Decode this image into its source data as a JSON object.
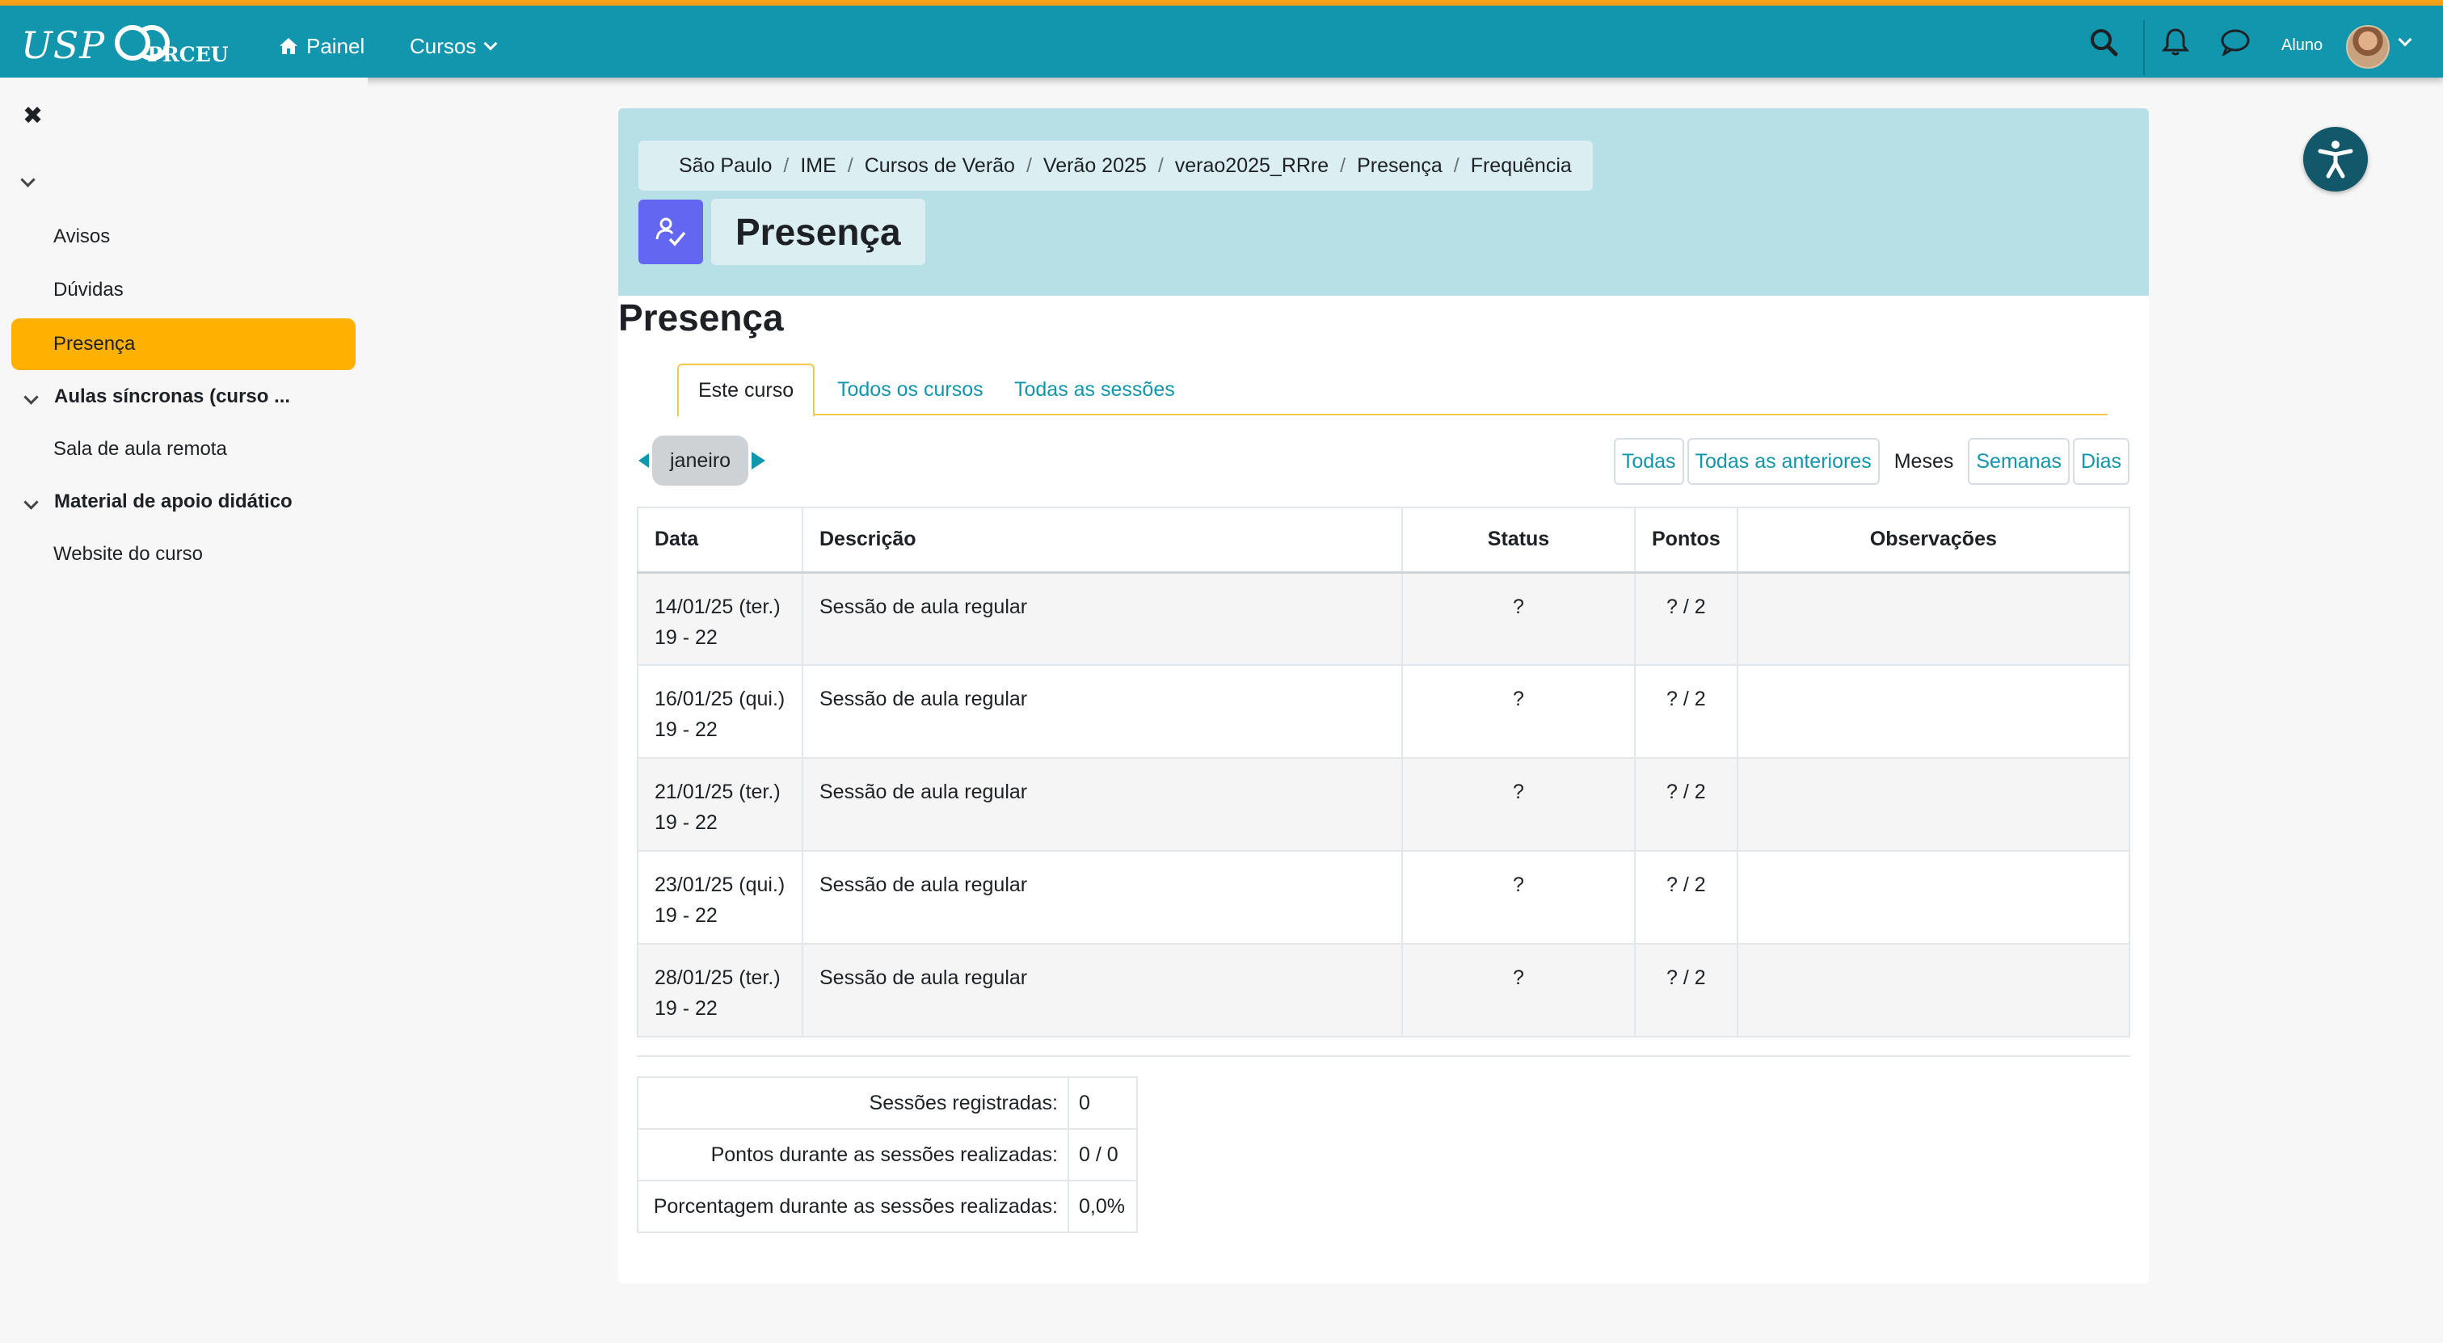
{
  "navbar": {
    "logo_text": "USP",
    "logo_sub": "PRCEU",
    "painel_label": "Painel",
    "cursos_label": "Cursos",
    "user_name": "Aluno",
    "colors": {
      "bar": "#1196ad",
      "accent": "#f5a21b"
    }
  },
  "sidebar": {
    "items": [
      {
        "label": "Avisos",
        "active": false
      },
      {
        "label": "Dúvidas",
        "active": false
      },
      {
        "label": "Presença",
        "active": true
      }
    ],
    "section_sync": "Aulas síncronas (curso ...",
    "section_sync_item": "Sala de aula remota",
    "section_material": "Material de apoio didático",
    "section_material_item": "Website do curso",
    "active_color": "#ffb000"
  },
  "breadcrumb": [
    "São Paulo",
    "IME",
    "Cursos de Verão",
    "Verão 2025",
    "verao2025_RRre",
    "Presença",
    "Frequência"
  ],
  "page_title": "Presença",
  "section_heading": "Presença",
  "tabs": [
    {
      "label": "Este curso",
      "active": true
    },
    {
      "label": "Todos os cursos",
      "active": false
    },
    {
      "label": "Todas as sessões",
      "active": false
    }
  ],
  "month": "janeiro",
  "view_filters": {
    "todas": "Todas",
    "anteriores": "Todas as anteriores",
    "meses": "Meses",
    "semanas": "Semanas",
    "dias": "Dias"
  },
  "table": {
    "headers": [
      "Data",
      "Descrição",
      "Status",
      "Pontos",
      "Observações"
    ],
    "rows": [
      {
        "date": "14/01/25 (ter.)",
        "time": "19 - 22",
        "desc": "Sessão de aula regular",
        "status": "?",
        "points": "? / 2",
        "obs": ""
      },
      {
        "date": "16/01/25 (qui.)",
        "time": "19 - 22",
        "desc": "Sessão de aula regular",
        "status": "?",
        "points": "? / 2",
        "obs": ""
      },
      {
        "date": "21/01/25 (ter.)",
        "time": "19 - 22",
        "desc": "Sessão de aula regular",
        "status": "?",
        "points": "? / 2",
        "obs": ""
      },
      {
        "date": "23/01/25 (qui.)",
        "time": "19 - 22",
        "desc": "Sessão de aula regular",
        "status": "?",
        "points": "? / 2",
        "obs": ""
      },
      {
        "date": "28/01/25 (ter.)",
        "time": "19 - 22",
        "desc": "Sessão de aula regular",
        "status": "?",
        "points": "? / 2",
        "obs": ""
      }
    ]
  },
  "summary": {
    "rows": [
      {
        "label": "Sessões registradas:",
        "value": "0"
      },
      {
        "label": "Pontos durante as sessões realizadas:",
        "value": "0 / 0"
      },
      {
        "label": "Porcentagem durante as sessões realizadas:",
        "value": "0,0%"
      }
    ]
  }
}
